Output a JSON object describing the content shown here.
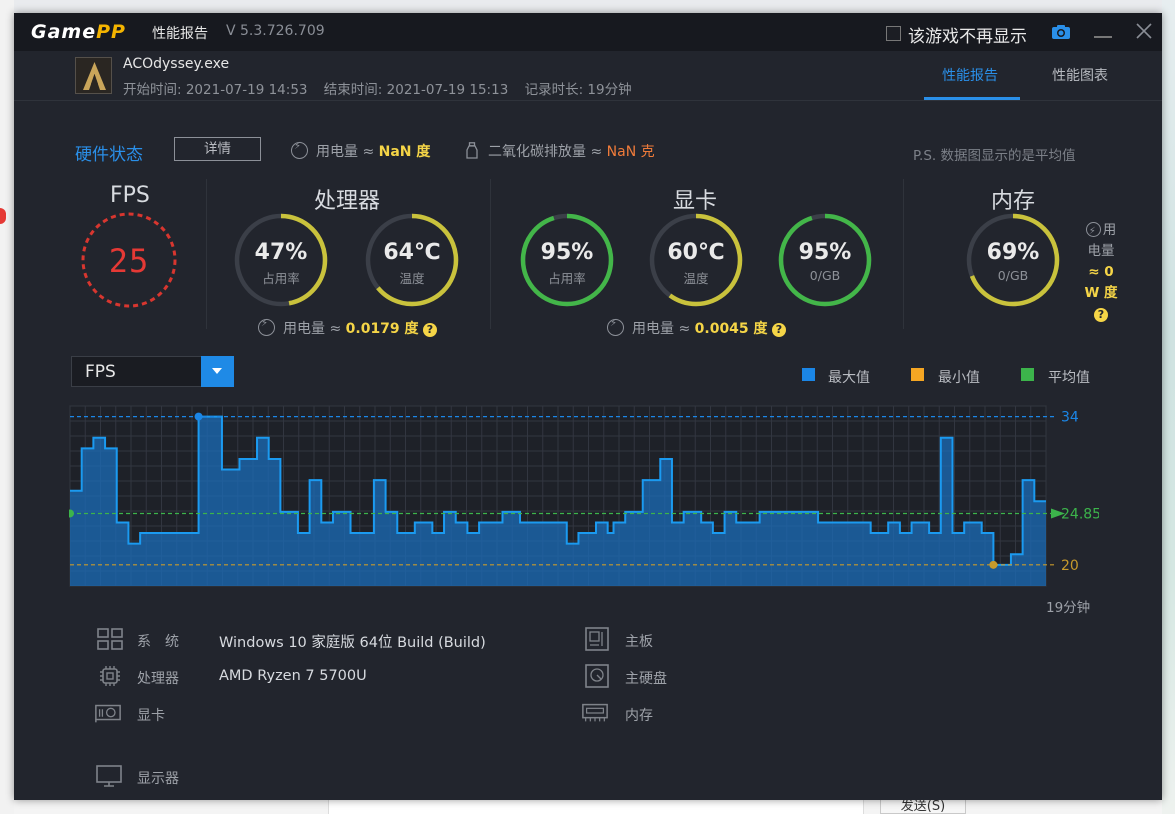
{
  "app": {
    "logo_main": "Game",
    "logo_accent": "PP",
    "title": "性能报告",
    "version": "V 5.3.726.709",
    "hide_game_label": "该游戏不再显示"
  },
  "header": {
    "game_name": "ACOdyssey.exe",
    "start_time": "开始时间: 2021-07-19 14:53",
    "end_time": "结束时间: 2021-07-19 15:13",
    "duration": "记录时长: 19分钟",
    "tabs": [
      {
        "label": "性能报告",
        "active": true
      },
      {
        "label": "性能图表",
        "active": false
      }
    ]
  },
  "hardware": {
    "title": "硬件状态",
    "detail_button": "详情",
    "power_label": "用电量 ≈ ",
    "power_value": "NaN 度",
    "co2_label": "二氧化碳排放量 ≈ ",
    "co2_value": "NaN 克",
    "note": "P.S. 数据图显示的是平均值"
  },
  "sections": {
    "fps": {
      "title": "FPS",
      "value": "25"
    },
    "cpu": {
      "title": "处理器",
      "usage": {
        "value": "47%",
        "label": "占用率",
        "percent": 47
      },
      "temp": {
        "value": "64℃",
        "label": "温度",
        "percent": 64
      },
      "power_label": "用电量 ≈ ",
      "power_value": "0.0179 度"
    },
    "gpu": {
      "title": "显卡",
      "usage": {
        "value": "95%",
        "label": "占用率",
        "percent": 95
      },
      "temp": {
        "value": "60℃",
        "label": "温度",
        "percent": 60
      },
      "mem": {
        "value": "95%",
        "label": "0/GB",
        "percent": 95
      },
      "power_label": "用电量 ≈ ",
      "power_value": "0.0045 度"
    },
    "memory": {
      "title": "内存",
      "usage": {
        "value": "69%",
        "label": "0/GB",
        "percent": 69
      },
      "power_line1": "用",
      "power_line2": "电量",
      "power_line3": "≈ 0",
      "power_line4": "W 度"
    }
  },
  "chart_controls": {
    "metric": "FPS",
    "legend": [
      {
        "label": "最大值",
        "color": "#1b86e6"
      },
      {
        "label": "最小值",
        "color": "#f5a623"
      },
      {
        "label": "平均值",
        "color": "#3cb44b"
      }
    ]
  },
  "chart_data": {
    "type": "area",
    "title": "",
    "x_label_end": "19分钟",
    "ylim": [
      18,
      35
    ],
    "max": {
      "value": 34,
      "label": "34"
    },
    "min": {
      "value": 20,
      "label": "20"
    },
    "avg": {
      "value": 24.85,
      "label": "24.85"
    },
    "values": [
      27,
      27,
      31,
      31,
      32,
      32,
      31,
      31,
      24,
      24,
      22,
      22,
      23,
      23,
      23,
      23,
      23,
      23,
      23,
      23,
      23,
      23,
      34,
      34,
      34,
      34,
      29,
      29,
      29,
      30,
      30,
      30,
      32,
      32,
      30,
      30,
      25,
      25,
      25,
      23,
      23,
      28,
      28,
      24,
      24,
      25,
      25,
      25,
      23,
      23,
      23,
      23,
      28,
      28,
      25,
      25,
      23,
      23,
      23,
      24,
      24,
      24,
      23,
      23,
      25,
      25,
      24,
      24,
      23,
      23,
      24,
      24,
      24,
      24,
      25,
      25,
      25,
      24,
      24,
      24,
      24,
      24,
      24,
      24,
      24,
      22,
      22,
      23,
      23,
      23,
      24,
      24,
      23,
      24,
      24,
      25,
      25,
      25,
      28,
      28,
      28,
      30,
      30,
      24,
      24,
      25,
      25,
      25,
      24,
      24,
      23,
      23,
      25,
      25,
      24,
      24,
      24,
      24,
      25,
      25,
      25,
      25,
      25,
      25,
      25,
      25,
      25,
      25,
      24,
      24,
      24,
      24,
      24,
      24,
      24,
      24,
      24,
      23,
      23,
      23,
      24,
      24,
      23,
      23,
      24,
      24,
      24,
      23,
      23,
      32,
      32,
      23,
      23,
      24,
      24,
      24,
      23,
      23,
      20,
      20,
      20,
      21,
      21,
      28,
      28,
      26,
      26
    ]
  },
  "system_info": {
    "os_label": "系　统",
    "os_value": "Windows 10 家庭版 64位   Build (Build)",
    "cpu_label": "处理器",
    "cpu_value": "AMD Ryzen 7 5700U",
    "gpu_label": "显卡",
    "monitor_label": "显示器",
    "board_label": "主板",
    "disk_label": "主硬盘",
    "ram_label": "内存"
  },
  "background": {
    "send_button": "发送(S)"
  },
  "colors": {
    "accent": "#2a8fe8",
    "fps_red": "#e53935",
    "gauge_yellow": "#c9c23c",
    "gauge_green": "#43b649",
    "chart_fill": "#1b6cb8",
    "chart_line": "#1b9af0"
  }
}
